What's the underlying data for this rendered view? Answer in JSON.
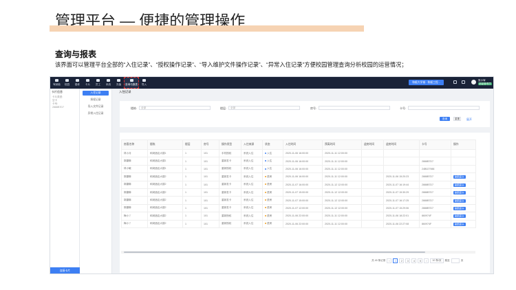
{
  "slide": {
    "title": "管理平台 — 便捷的管理操作",
    "section_title": "查询与报表",
    "description": "该界面可以管理平台全部的“入住记录”、“授权操作记录”、“导入维护文件操作记录”、“异常入住记录”方便校园管理查询分析校园的运营情况；"
  },
  "topnav": [
    {
      "label": "驾驶舱"
    },
    {
      "label": "校园"
    },
    {
      "label": "楼栋"
    },
    {
      "label": "卡片"
    },
    {
      "label": "员工"
    },
    {
      "label": "系统"
    },
    {
      "label": "充值"
    },
    {
      "label": "查询与报表"
    },
    {
      "label": "导入"
    }
  ],
  "header": {
    "school_select": "和顺大学城 · 和顺工程...",
    "user_name": "张小军",
    "user_role": "超级管理员"
  },
  "leftbar": {
    "title": "卡片信息",
    "lines": [
      "卡片类型:",
      "空卡",
      "卡号:",
      "2888B7D7"
    ],
    "bottom_button": "连接卡片"
  },
  "submenu": [
    {
      "label": "入住记录",
      "active": true
    },
    {
      "label": "授权记录",
      "active": false
    },
    {
      "label": "导入文件记录",
      "active": false
    },
    {
      "label": "异常入住记录",
      "active": false
    }
  ],
  "tab": {
    "label": "入住记录"
  },
  "filters": {
    "building_label": "楼栋:",
    "building_value": "全部",
    "floor_label": "楼层:",
    "floor_value": "全部",
    "room_label": "房号:",
    "card_label": "卡号:",
    "query_button": "查询",
    "reset_button": "重置",
    "expand_link": "展开"
  },
  "table": {
    "headers": [
      "房客名称",
      "楼栋",
      "楼层",
      "房号",
      "操作类型",
      "入住来源",
      "状态",
      "入住时间",
      "预离时间",
      "退房时间",
      "退房时间",
      "卡号",
      "操作"
    ],
    "rows": [
      [
        "林小月",
        "和润酒店大楼1",
        "1",
        "101",
        "手机授权",
        "系统入住",
        "入住",
        "2020-11-06 16:00:00",
        "2020-11-11 12:00:00",
        "",
        "",
        "",
        ""
      ],
      [
        "郭婕琳",
        "和润酒店大楼1",
        "1",
        "101",
        "重新发卡",
        "系统入住",
        "入住",
        "2020-11-06 16:00:00",
        "2020-11-11 12:00:00",
        "",
        "",
        "2888B7D7",
        ""
      ],
      [
        "林小敏",
        "和润酒店大楼1",
        "1",
        "101",
        "重新授权",
        "系统入住",
        "入住",
        "2020-11-06 16:00:00",
        "2020-11-11 12:00:00",
        "",
        "",
        "24B027988",
        ""
      ],
      [
        "郭婕琳",
        "和润酒店大楼2",
        "1",
        "101",
        "重新发卡",
        "系统入住",
        "退房",
        "2020-11-06 16:00:00",
        "2020-11-11 12:00:00",
        "",
        "2020-11-06 15:20:23",
        "2888B7D7",
        "刷新房卡"
      ],
      [
        "郭婕琳",
        "和润酒店大楼2",
        "1",
        "101",
        "重新发卡",
        "系统入住",
        "退房",
        "2020-11-07 16:00:00",
        "2020-11-12 12:00:00",
        "",
        "2020-11-07 16:19:44",
        "2888B7D7",
        "刷新房卡"
      ],
      [
        "郭婕琳",
        "和润酒店大楼2",
        "1",
        "101",
        "重新发卡",
        "系统入住",
        "退房",
        "2020-11-07 15:00:00",
        "2020-11-12 12:00:00",
        "",
        "2020-11-07 15:30:29",
        "2888B7D7",
        "刷新房卡"
      ],
      [
        "郭婕琳",
        "和润酒店大楼2",
        "1",
        "101",
        "重新发卡",
        "系统入住",
        "退房",
        "2020-11-07 15:00:00",
        "2020-11-12 12:00:00",
        "",
        "2020-11-07 16:17:25",
        "2888B7D7",
        "刷新房卡"
      ],
      [
        "郭婕琳",
        "和润酒店大楼2",
        "1",
        "101",
        "重新发卡",
        "系统入住",
        "退房",
        "2020-11-07 12:00:00",
        "2020-11-12 12:00:00",
        "",
        "2020-11-07 15:29:06",
        "2888B7D7",
        "刷新房卡"
      ],
      [
        "梅小丫",
        "和润酒店大楼2",
        "1",
        "101",
        "重新授权",
        "系统入住",
        "退房",
        "2020-11-06 22:00:00",
        "2020-11-11 12:00:00",
        "",
        "2020-11-06 18:22:01",
        "860974F",
        "刷新房卡"
      ],
      [
        "梅小丫",
        "和润酒店大楼2",
        "1",
        "101",
        "重新授权",
        "系统入住",
        "退房",
        "2020-11-06 22:00:00",
        "2020-11-11 12:00:00",
        "",
        "2020-11-06 22:27:08",
        "860974F",
        "刷新房卡"
      ]
    ]
  },
  "pagination": {
    "total": "共 45 条记录",
    "pages": [
      "1",
      "2",
      "3",
      "4",
      "5"
    ],
    "page_size": "10 条/页",
    "goto_label": "跳至",
    "page_unit": "页"
  },
  "colors": {
    "accent": "#3d7ff3",
    "topbar": "#1a2338",
    "title_bar": "#f6d3b3",
    "status_in": "#3d7ff3",
    "status_out": "#f0a020"
  }
}
